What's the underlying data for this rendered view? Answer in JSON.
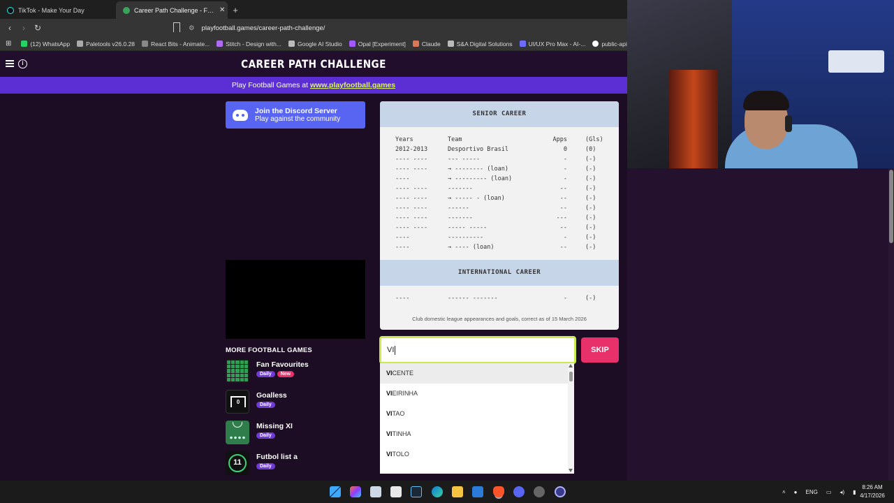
{
  "browser": {
    "tabs": [
      {
        "title": "TikTok - Make Your Day",
        "active": false
      },
      {
        "title": "Career Path Challenge - Football",
        "active": true
      }
    ],
    "url": "playfootball.games/career-path-challenge/",
    "bookmarks": [
      {
        "label": "(12) WhatsApp",
        "color": "#25d366"
      },
      {
        "label": "Paletools v26.0.28",
        "color": "#aaaaaa"
      },
      {
        "label": "React Bits - Animate...",
        "color": "#888888"
      },
      {
        "label": "Stitch - Design with...",
        "color": "#b06cf0"
      },
      {
        "label": "Google AI Studio",
        "color": "#bbbbbb"
      },
      {
        "label": "Opal [Experiment]",
        "color": "#a259ff"
      },
      {
        "label": "Claude",
        "color": "#d97757"
      },
      {
        "label": "S&A Digital Solutions",
        "color": "#bbbbbb"
      },
      {
        "label": "UI/UX Pro Max - AI-...",
        "color": "#6c6cff"
      },
      {
        "label": "public-apis/",
        "color": "#ffffff"
      }
    ]
  },
  "site": {
    "title": "CAREER PATH CHALLENGE",
    "banner_text": "Play Football Games at ",
    "banner_link": "www.playfootball.games",
    "discord_title": "Join the Discord Server",
    "discord_sub": "Play against the community",
    "more_games_title": "MORE FOOTBALL GAMES",
    "games": [
      {
        "name": "Fan Favourites",
        "badges": [
          "Daily",
          "New"
        ]
      },
      {
        "name": "Goalless",
        "badges": [
          "Daily"
        ]
      },
      {
        "name": "Missing XI",
        "badges": [
          "Daily"
        ]
      },
      {
        "name": "Futbol list a",
        "badges": [
          "Daily"
        ]
      }
    ],
    "goalless_number": "0",
    "futbol_number": "11"
  },
  "career": {
    "senior_title": "SENIOR CAREER",
    "headers": {
      "years": "Years",
      "team": "Team",
      "apps": "Apps",
      "gls": "(Gls)"
    },
    "rows": [
      {
        "years": "2012-2013",
        "team": "Desportivo Brasil",
        "apps": "0",
        "gls": "(0)"
      },
      {
        "years": "---- ----",
        "team": "--- -----",
        "apps": "-",
        "gls": "(-)"
      },
      {
        "years": "---- ----",
        "team": "→ -------- (loan)",
        "apps": "-",
        "gls": "(-)"
      },
      {
        "years": "----",
        "team": "→ --------- (loan)",
        "apps": "-",
        "gls": "(-)"
      },
      {
        "years": "---- ----",
        "team": "-------",
        "apps": "--",
        "gls": "(-)"
      },
      {
        "years": "---- ----",
        "team": "→ ----- - (loan)",
        "apps": "--",
        "gls": "(-)"
      },
      {
        "years": "---- ----",
        "team": "------",
        "apps": "--",
        "gls": "(-)"
      },
      {
        "years": "---- ----",
        "team": "-------",
        "apps": "---",
        "gls": "(-)"
      },
      {
        "years": "---- ----",
        "team": "----- -----",
        "apps": "--",
        "gls": "(-)"
      },
      {
        "years": "----",
        "team": "----------",
        "apps": "-",
        "gls": "(-)"
      },
      {
        "years": "----",
        "team": "→ ---- (loan)",
        "apps": "--",
        "gls": "(-)"
      }
    ],
    "intl_title": "INTERNATIONAL CAREER",
    "intl_row": {
      "years": "----",
      "team": "------ -------",
      "apps": "-",
      "gls": "(-)"
    },
    "footnote": "Club domestic league appearances and goals, correct as of 15 March 2026"
  },
  "guess": {
    "value": "VI",
    "skip_label": "SKIP",
    "suggestions": [
      {
        "match": "VI",
        "rest": "CENTE"
      },
      {
        "match": "VI",
        "rest": "EIRINHA"
      },
      {
        "match": "VI",
        "rest": "TAO"
      },
      {
        "match": "VI",
        "rest": "TINHA"
      },
      {
        "match": "VI",
        "rest": "TOLO"
      }
    ]
  },
  "taskbar": {
    "lang": "ENG",
    "time": "8:26 AM",
    "date": "4/17/2026"
  }
}
